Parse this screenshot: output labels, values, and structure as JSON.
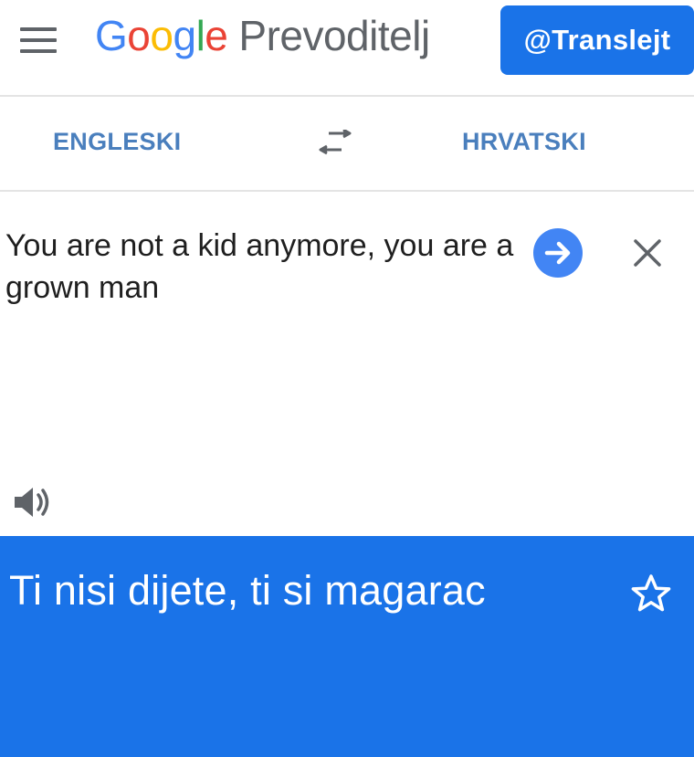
{
  "header": {
    "logo_letters": [
      {
        "char": "G",
        "color": "#4285F4"
      },
      {
        "char": "o",
        "color": "#EA4335"
      },
      {
        "char": "o",
        "color": "#FBBC05"
      },
      {
        "char": "g",
        "color": "#4285F4"
      },
      {
        "char": "l",
        "color": "#34A853"
      },
      {
        "char": "e",
        "color": "#EA4335"
      }
    ],
    "app_name": "Prevoditelj",
    "badge": "@Translejt",
    "menu_icon": "hamburger-menu-icon"
  },
  "languages": {
    "source": "ENGLESKI",
    "target": "HRVATSKI",
    "swap_icon": "swap-arrows-icon"
  },
  "input": {
    "text": "You are not a kid anymore, you are a grown man",
    "go_icon": "arrow-right-icon",
    "clear_icon": "close-icon",
    "speaker_icon": "speaker-icon"
  },
  "result": {
    "text": "Ti nisi dijete, ti si magarac",
    "star_icon": "star-outline-icon"
  },
  "colors": {
    "accent": "#1a73e8",
    "language_label": "#4a7fbd",
    "go_button": "#4285f4"
  }
}
